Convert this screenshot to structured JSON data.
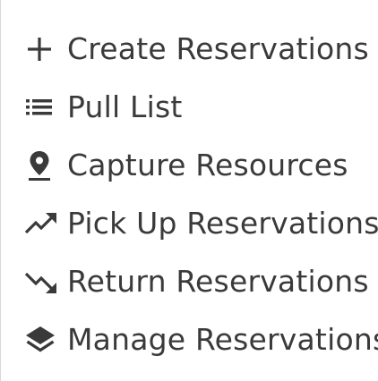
{
  "menu": {
    "items": [
      {
        "label": "Create Reservations",
        "icon": "plus-icon"
      },
      {
        "label": "Pull List",
        "icon": "list-icon"
      },
      {
        "label": "Capture Resources",
        "icon": "map-pin-icon"
      },
      {
        "label": "Pick Up Reservations",
        "icon": "trending-up-icon"
      },
      {
        "label": "Return Reservations",
        "icon": "trending-down-icon"
      },
      {
        "label": "Manage Reservations",
        "icon": "layers-icon"
      }
    ]
  },
  "colors": {
    "text": "#3a3a3a",
    "background": "#ffffff",
    "border": "#d9d9d9"
  }
}
